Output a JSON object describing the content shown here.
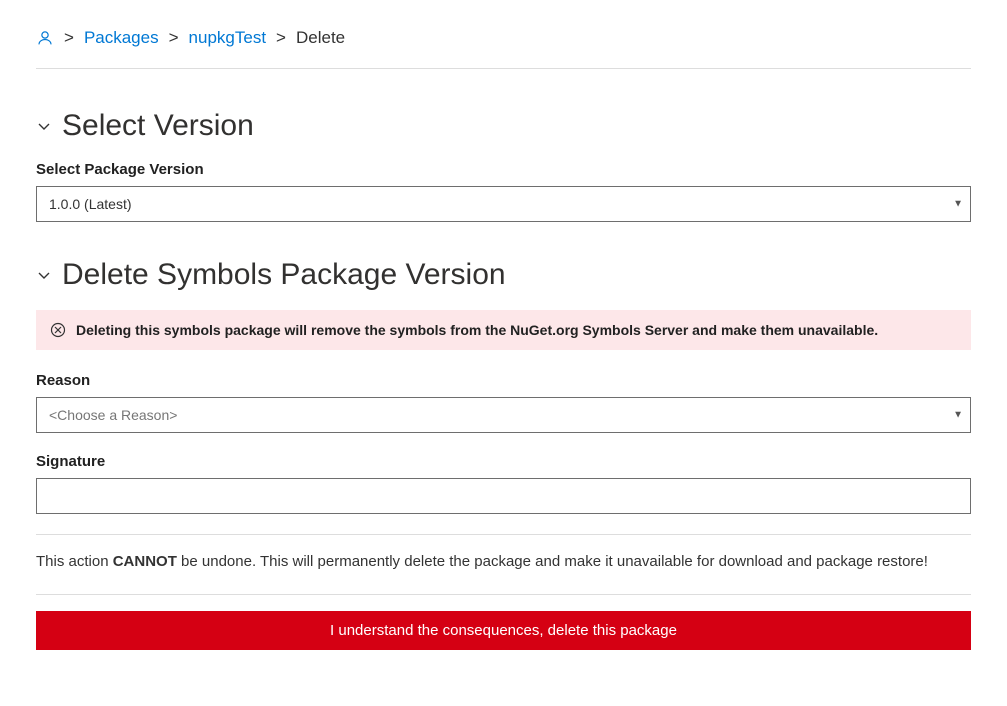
{
  "breadcrumbs": {
    "packages": "Packages",
    "package_name": "nupkgTest",
    "current": "Delete"
  },
  "select_version": {
    "heading": "Select Version",
    "label": "Select Package Version",
    "selected": "1.0.0 (Latest)",
    "options": [
      "1.0.0 (Latest)"
    ]
  },
  "delete_symbols": {
    "heading": "Delete Symbols Package Version",
    "warning": "Deleting this symbols package will remove the  symbols from the NuGet.org Symbols Server and make them unavailable.",
    "reason_label": "Reason",
    "reason_placeholder": "<Choose a Reason>",
    "reason_options": [
      "<Choose a Reason>"
    ],
    "signature_label": "Signature",
    "signature_value": "",
    "cannot_undo_prefix": "This action ",
    "cannot_undo_strong": "CANNOT",
    "cannot_undo_suffix": " be undone. This will permanently delete the package and make it unavailable for download and package restore!",
    "button_label": "I understand the consequences, delete this package"
  }
}
